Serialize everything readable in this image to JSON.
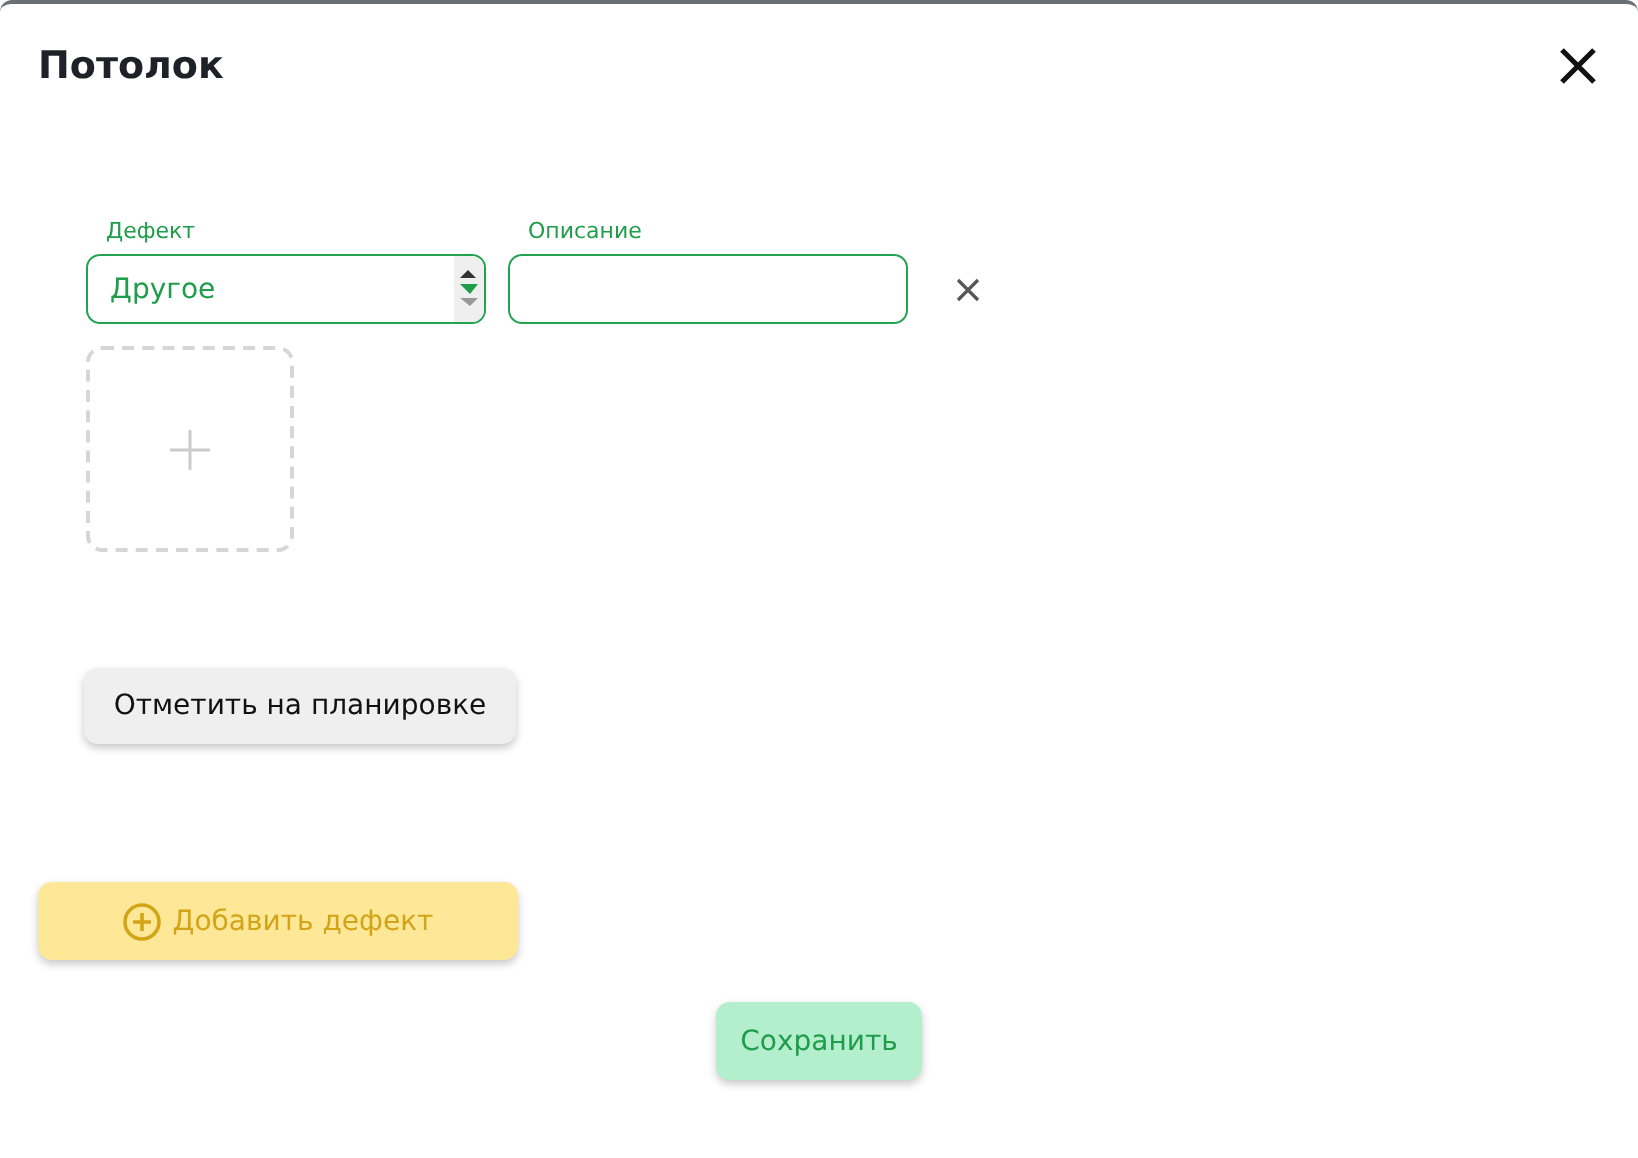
{
  "dialog": {
    "title": "Потолок"
  },
  "defects": [
    {
      "defect": {
        "label": "Дефект",
        "value": "Другое"
      },
      "description": {
        "label": "Описание"
      }
    }
  ],
  "mark_button": "Отметить на планировке",
  "add_button": "Добавить дефект",
  "save_button": "Сохранить"
}
